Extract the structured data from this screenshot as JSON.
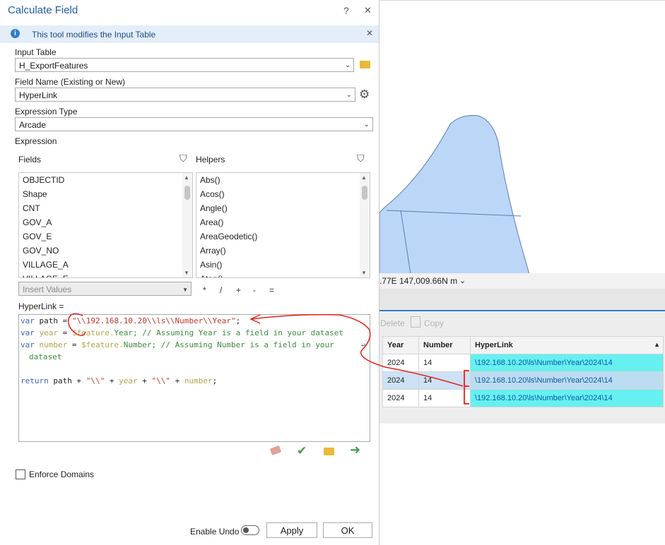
{
  "dialog": {
    "title": "Calculate Field",
    "help": "?",
    "close": "✕",
    "info_text": "This tool modifies the Input Table",
    "input_table_label": "Input Table",
    "input_table_value": "H_ExportFeatures",
    "field_name_label": "Field Name (Existing or New)",
    "field_name_value": "HyperLink",
    "expression_type_label": "Expression Type",
    "expression_type_value": "Arcade",
    "expression_label": "Expression",
    "fields_label": "Fields",
    "helpers_label": "Helpers",
    "fields": [
      "OBJECTID",
      "Shape",
      "CNT",
      "GOV_A",
      "GOV_E",
      "GOV_NO",
      "VILLAGE_A",
      "VILLAGE_E"
    ],
    "helpers": [
      "Abs()",
      "Acos()",
      "Angle()",
      "Area()",
      "AreaGeodetic()",
      "Array()",
      "Asin()",
      "Atan()"
    ],
    "insert_values_placeholder": "Insert Values",
    "operators": [
      "*",
      "/",
      "+",
      "-",
      "="
    ],
    "target_label": "HyperLink =",
    "code": {
      "line1_kw": "var",
      "line1_name": " path = ",
      "line1_str": "\"\\\\192.168.10.20\\\\ls\\\\Number\\\\Year\"",
      "line1_end": ";",
      "line2_kw": "var",
      "line2_name": " year",
      "line2_eq": " = ",
      "line2_feat": "$feature.",
      "line2_field": "Year",
      "line2_comment": "; // Assuming Year is a field in your dataset",
      "line3_kw": "var",
      "line3_name": " number",
      "line3_eq": " = ",
      "line3_feat": "$feature.",
      "line3_field": "Number",
      "line3_comment": "; // Assuming Number is a field in your",
      "line4": "dataset",
      "line5_kw": "return",
      "line5_a": " path + ",
      "line5_s1": "\"\\\\\"",
      "line5_b": " + ",
      "line5_year": "year",
      "line5_c": " + ",
      "line5_s2": "\"\\\\\"",
      "line5_d": " + ",
      "line5_number": "number",
      "line5_end": ";"
    },
    "enforce_domains_label": "Enforce Domains",
    "enable_undo_label": "Enable Undo",
    "apply_label": "Apply",
    "ok_label": "OK"
  },
  "map": {
    "coord_text": ".77E 147,009.66N m",
    "polygon_fill": "#bcd6f7",
    "polygon_stroke": "#5a7fb0"
  },
  "attribute_table": {
    "toolbar_delete": "Delete",
    "toolbar_copy": "Copy",
    "columns": [
      "Year",
      "Number",
      "HyperLink"
    ],
    "rows": [
      {
        "year": "2024",
        "number": "14",
        "link": "\\192.168.10.20\\ls\\Number\\Year\\2024\\14"
      },
      {
        "year": "2024",
        "number": "14",
        "link": "\\192.168.10.20\\ls\\Number\\Year\\2024\\14"
      },
      {
        "year": "2024",
        "number": "14",
        "link": "\\192.168.10.20\\ls\\Number\\Year\\2024\\14"
      }
    ],
    "link_color": "#66f0f0"
  },
  "annotation_color": "#e8201b"
}
